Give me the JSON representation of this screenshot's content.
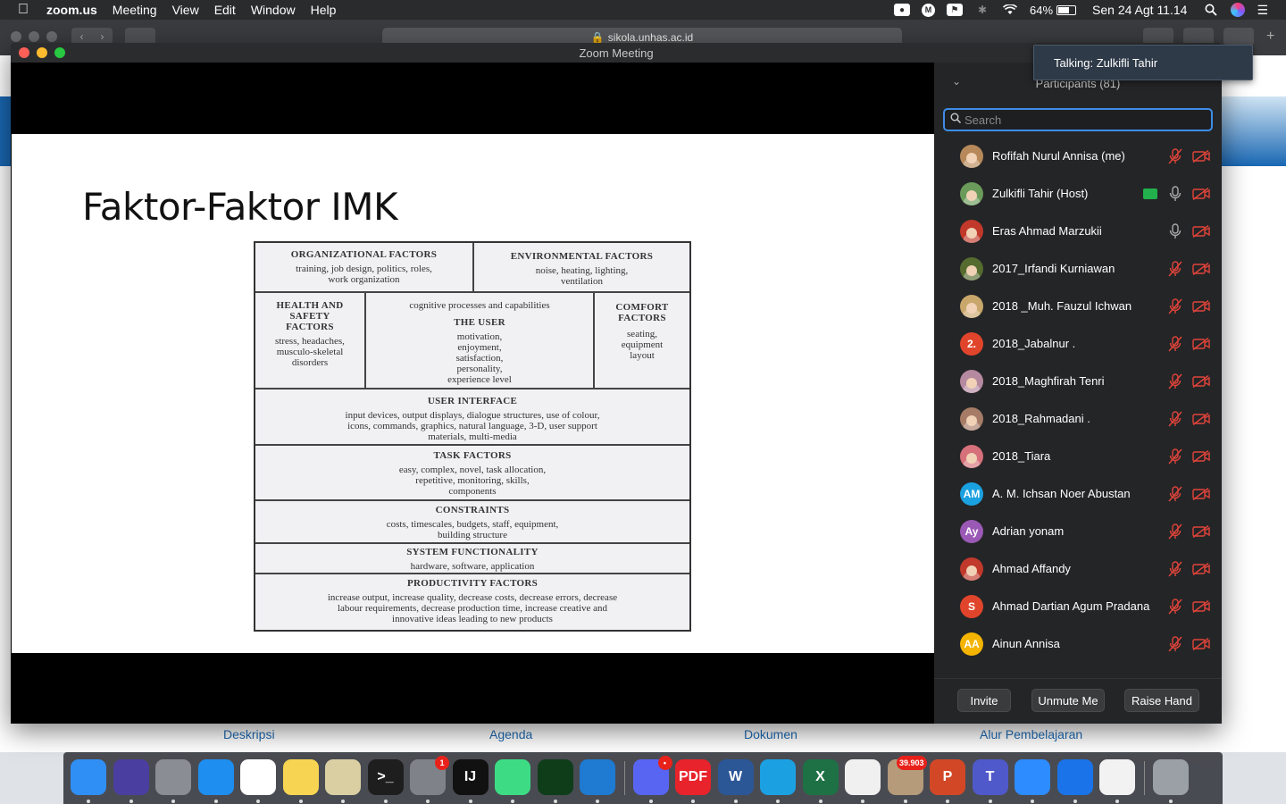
{
  "menubar": {
    "app_name": "zoom.us",
    "menus": [
      "Meeting",
      "View",
      "Edit",
      "Window",
      "Help"
    ],
    "battery": "64%",
    "clock": "Sen 24 Agt  11.14"
  },
  "safari": {
    "url": "sikola.unhas.ac.id",
    "links": [
      "Deskripsi",
      "Agenda",
      "Dokumen",
      "Alur Pembelajaran"
    ]
  },
  "zoom": {
    "window_title": "Zoom Meeting",
    "talking": "Talking: Zulkifli Tahir",
    "slide": {
      "title": "Faktor-Faktor IMK",
      "figure": {
        "organizational": {
          "title": "ORGANIZATIONAL FACTORS",
          "body": "training, job design, politics, roles, work organization"
        },
        "environmental": {
          "title": "ENVIRONMENTAL FACTORS",
          "body": "noise, heating, lighting, ventilation"
        },
        "health": {
          "title": "HEALTH AND SAFETY FACTORS",
          "body": "stress, headaches, musculo-skeletal disorders"
        },
        "user": {
          "top": "cognitive processes and capabilities",
          "title": "THE USER",
          "body": "motivation, enjoyment, satisfaction, personality, experience level"
        },
        "comfort": {
          "title": "COMFORT FACTORS",
          "body": "seating, equipment layout"
        },
        "user_interface": {
          "title": "USER INTERFACE",
          "body": "input devices, output displays, dialogue structures, use of colour, icons, commands, graphics, natural language, 3-D, user support materials, multi-media"
        },
        "task": {
          "title": "TASK FACTORS",
          "body": "easy, complex, novel, task allocation, repetitive, monitoring, skills, components"
        },
        "constraints": {
          "title": "CONSTRAINTS",
          "body": "costs, timescales, budgets, staff, equipment, building structure"
        },
        "system": {
          "title": "SYSTEM FUNCTIONALITY",
          "body": "hardware, software, application"
        },
        "productivity": {
          "title": "PRODUCTIVITY FACTORS",
          "body": "increase output, increase quality, decrease costs, decrease errors, decrease labour requirements, decrease production time, increase creative and innovative ideas leading to new products"
        }
      }
    },
    "participants": {
      "title": "Participants (81)",
      "search_placeholder": "Search",
      "list": [
        {
          "name": "Rofifah Nurul Annisa (me)",
          "avatar": "",
          "color": "#b7895a",
          "mic": "muted",
          "cam": "off"
        },
        {
          "name": "Zulkifli Tahir (Host)",
          "avatar": "",
          "color": "#6b9b5a",
          "mic": "on",
          "cam": "off",
          "sharing": true
        },
        {
          "name": "Eras Ahmad Marzukii",
          "avatar": "",
          "color": "#c0392b",
          "mic": "on",
          "cam": "off"
        },
        {
          "name": "2017_Irfandi Kurniawan",
          "avatar": "",
          "color": "#556b2f",
          "mic": "muted",
          "cam": "off"
        },
        {
          "name": "2018 _Muh. Fauzul Ichwan",
          "avatar": "",
          "color": "#c9a76b",
          "mic": "muted",
          "cam": "off"
        },
        {
          "name": "2018_Jabalnur .",
          "avatar": "2.",
          "color": "#e0452b",
          "mic": "muted",
          "cam": "off"
        },
        {
          "name": "2018_Maghfirah Tenri",
          "avatar": "",
          "color": "#b589a0",
          "mic": "muted",
          "cam": "off"
        },
        {
          "name": "2018_Rahmadani .",
          "avatar": "",
          "color": "#a67c66",
          "mic": "muted",
          "cam": "off"
        },
        {
          "name": "2018_Tiara",
          "avatar": "",
          "color": "#d6707a",
          "mic": "muted",
          "cam": "off"
        },
        {
          "name": "A. M. Ichsan Noer Abustan",
          "avatar": "AM",
          "color": "#1aa1e0",
          "mic": "muted",
          "cam": "off"
        },
        {
          "name": "Adrian yonam",
          "avatar": "Ay",
          "color": "#9b59b6",
          "mic": "muted",
          "cam": "off"
        },
        {
          "name": "Ahmad Affandy",
          "avatar": "",
          "color": "#c0392b",
          "mic": "muted",
          "cam": "off"
        },
        {
          "name": "Ahmad Dartian Agum Pradana",
          "avatar": "S",
          "color": "#e0452b",
          "mic": "muted",
          "cam": "off"
        },
        {
          "name": "Ainun Annisa",
          "avatar": "AA",
          "color": "#f4b400",
          "mic": "muted",
          "cam": "off"
        }
      ],
      "buttons": {
        "invite": "Invite",
        "unmute": "Unmute Me",
        "raise_hand": "Raise Hand"
      }
    }
  },
  "dock": {
    "apps": [
      {
        "name": "Finder",
        "color": "#2f8ff5",
        "label": ""
      },
      {
        "name": "Siri",
        "color": "#4a3fa0",
        "label": ""
      },
      {
        "name": "Launchpad",
        "color": "#8a8d94",
        "label": ""
      },
      {
        "name": "Safari",
        "color": "#1e8ef0",
        "label": ""
      },
      {
        "name": "Chrome",
        "color": "#ffffff",
        "label": ""
      },
      {
        "name": "Notes",
        "color": "#f7d552",
        "label": ""
      },
      {
        "name": "Preview",
        "color": "#d9cfa3",
        "label": ""
      },
      {
        "name": "Terminal",
        "color": "#1e1e1e",
        "label": ">_"
      },
      {
        "name": "System Preferences",
        "color": "#7f8289",
        "label": "",
        "badge": "1"
      },
      {
        "name": "IntelliJ IDEA",
        "color": "#111111",
        "label": "IJ"
      },
      {
        "name": "Android Studio",
        "color": "#3ddc84",
        "label": ""
      },
      {
        "name": "Sync",
        "color": "#0f3d1a",
        "label": ""
      },
      {
        "name": "VS Code",
        "color": "#1f7ad1",
        "label": ""
      },
      {
        "name": "Discord",
        "color": "#5865f2",
        "label": "",
        "badge": "•"
      },
      {
        "name": "PDF Reader",
        "color": "#e8232b",
        "label": "PDF"
      },
      {
        "name": "Word",
        "color": "#2b5797",
        "label": "W"
      },
      {
        "name": "Remote",
        "color": "#1ba1e2",
        "label": ""
      },
      {
        "name": "Excel",
        "color": "#1e7145",
        "label": "X"
      },
      {
        "name": "iTunes",
        "color": "#f0f0f0",
        "label": ""
      },
      {
        "name": "Mail Stamp",
        "color": "#b59b7a",
        "label": "",
        "badge": "39.903"
      },
      {
        "name": "PowerPoint",
        "color": "#d24726",
        "label": "P"
      },
      {
        "name": "Teams",
        "color": "#5059c9",
        "label": "T"
      },
      {
        "name": "Zoom",
        "color": "#2d8cff",
        "label": ""
      },
      {
        "name": "Bluetooth",
        "color": "#1a73e8",
        "label": ""
      },
      {
        "name": "TextEdit",
        "color": "#f2f2f2",
        "label": ""
      },
      {
        "name": "Trash",
        "color": "#9aa0a6",
        "label": ""
      }
    ]
  }
}
